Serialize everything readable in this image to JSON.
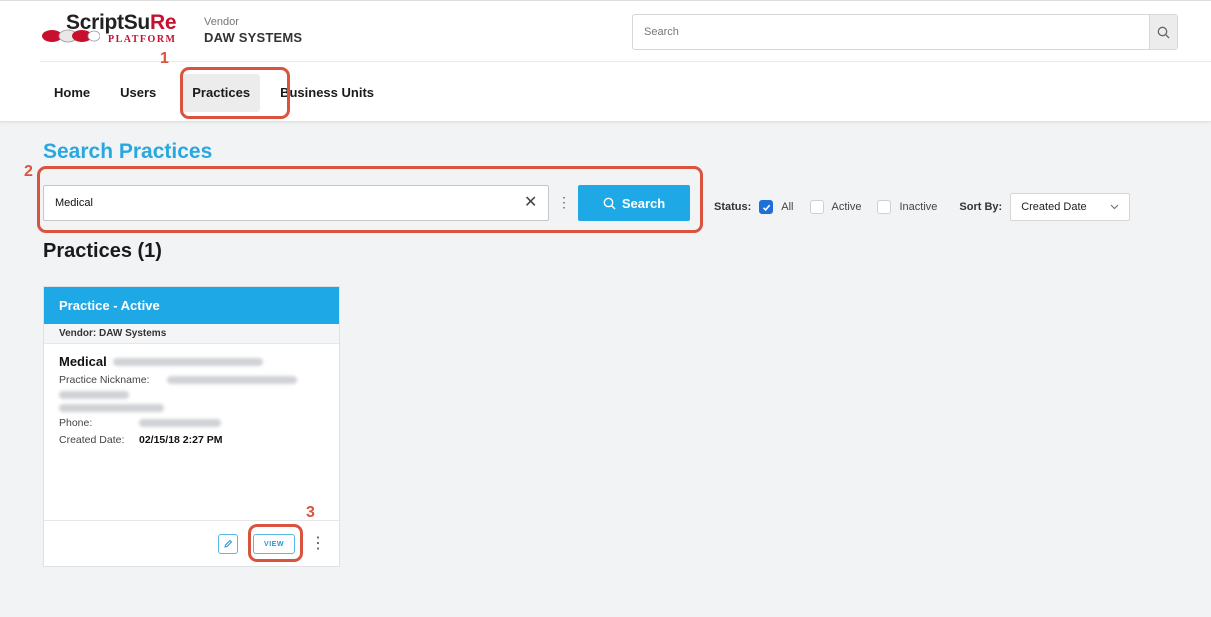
{
  "header": {
    "logo_text_main": "ScriptSu",
    "logo_text_rx": "Re",
    "logo_sub": "PLATFORM",
    "vendor_label": "Vendor",
    "vendor_name": "DAW SYSTEMS",
    "search_placeholder": "Search"
  },
  "nav": {
    "items": [
      {
        "label": "Home"
      },
      {
        "label": "Users"
      },
      {
        "label": "Practices"
      },
      {
        "label": "Business Units"
      }
    ],
    "active": "Practices"
  },
  "callouts": [
    "1",
    "2",
    "3"
  ],
  "main": {
    "title": "Search Practices",
    "query": "Medical",
    "search_button": "Search",
    "status_label": "Status:",
    "status_options": [
      {
        "label": "All",
        "checked": true
      },
      {
        "label": "Active",
        "checked": false
      },
      {
        "label": "Inactive",
        "checked": false
      }
    ],
    "sort_label": "Sort By:",
    "sort_value": "Created Date",
    "results_title": "Practices (1)"
  },
  "card": {
    "header": "Practice - Active",
    "vendor": "Vendor: DAW Systems",
    "name": "Medical",
    "nickname_label": "Practice Nickname:",
    "phone_label": "Phone:",
    "created_label": "Created Date:",
    "created_value": "02/15/18 2:27 PM",
    "view_label": "VIEW"
  },
  "colors": {
    "accent": "#1ea9e6",
    "callout": "#d9533f",
    "checkbox": "#1e6fd6"
  }
}
